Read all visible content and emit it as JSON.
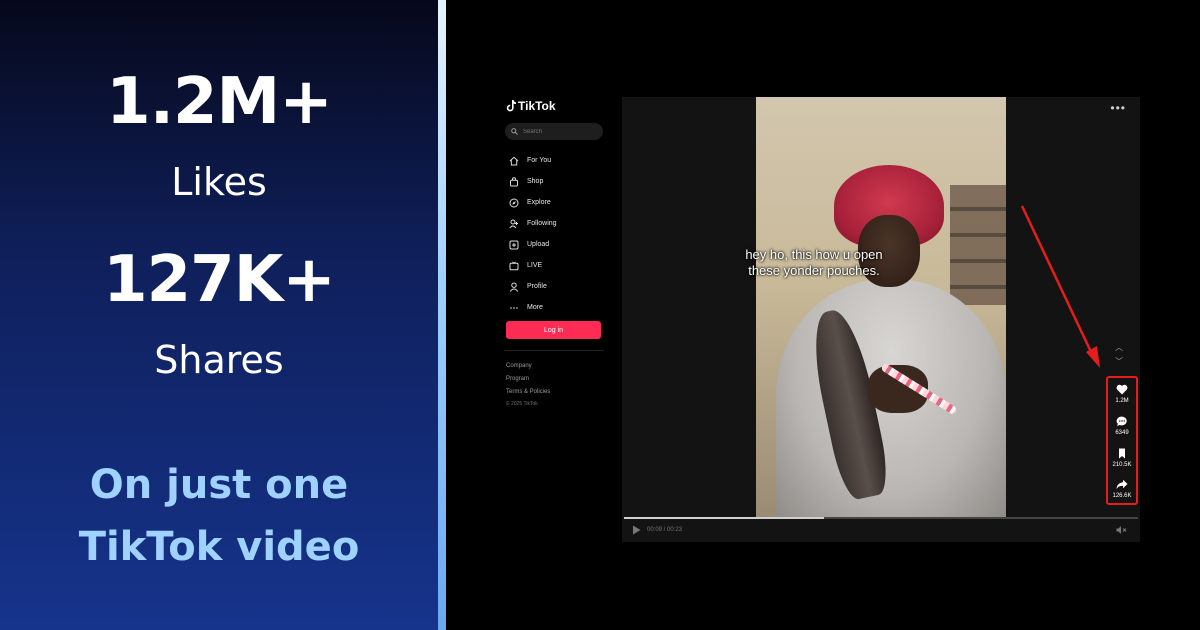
{
  "promo": {
    "likes_value": "1.2M+",
    "likes_label": "Likes",
    "shares_value": "127K+",
    "shares_label": "Shares",
    "tagline_line1": "On just one",
    "tagline_line2": "TikTok video"
  },
  "tiktok": {
    "logo": "TikTok",
    "search_placeholder": "Search",
    "nav": [
      {
        "label": "For You",
        "icon": "home-icon"
      },
      {
        "label": "Shop",
        "icon": "shopping-bag-icon"
      },
      {
        "label": "Explore",
        "icon": "compass-icon"
      },
      {
        "label": "Following",
        "icon": "person-add-icon"
      },
      {
        "label": "Upload",
        "icon": "upload-icon"
      },
      {
        "label": "LIVE",
        "icon": "live-tv-icon"
      },
      {
        "label": "Profile",
        "icon": "person-icon"
      },
      {
        "label": "More",
        "icon": "more-dots-icon"
      }
    ],
    "login_label": "Log in",
    "footer": {
      "links": [
        "Company",
        "Program",
        "Terms & Policies"
      ],
      "copyright": "© 2025 TikTok"
    },
    "video": {
      "caption_line1": "hey ho, this how u open",
      "caption_line2": "these yonder pouches.",
      "time": "00:09 / 00:23",
      "progress_fraction": 0.39
    },
    "actions": {
      "likes": "1.2M",
      "comments": "6349",
      "saves": "210.5K",
      "shares": "126.6K"
    },
    "colors": {
      "accent": "#fe2c55",
      "highlight": "#e51d1d"
    }
  }
}
